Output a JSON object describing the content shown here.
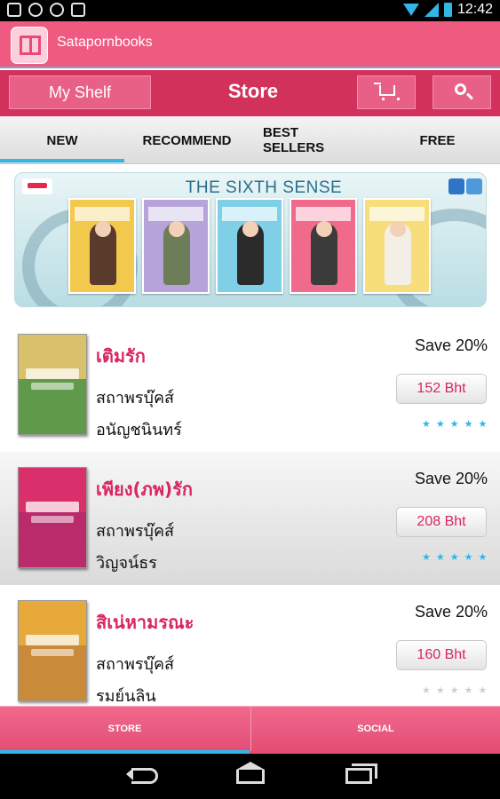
{
  "status_bar": {
    "time": "12:42",
    "icons": [
      "image-icon",
      "cloud-upload-icon",
      "clock-icon",
      "bag-icon"
    ],
    "right_icons": [
      "wifi-icon",
      "signal-icon",
      "battery-icon"
    ]
  },
  "app_bar": {
    "title": "Satapornbooks"
  },
  "header": {
    "my_shelf_label": "My Shelf",
    "store_title": "Store"
  },
  "tabs": [
    {
      "label": "NEW",
      "selected": true
    },
    {
      "label": "RECOMMEND",
      "selected": false
    },
    {
      "label": "BEST\nSELLERS",
      "selected": false
    },
    {
      "label": "FREE",
      "selected": false
    }
  ],
  "banner": {
    "title": "THE SIXTH SENSE"
  },
  "books": [
    {
      "title": "เติมรัก",
      "publisher": "สถาพรบุ๊คส์",
      "author": "อนัญชนินทร์",
      "save": "Save 20%",
      "price": "152 Bht",
      "rating_active": true
    },
    {
      "title": "เพียง(ภพ)รัก",
      "publisher": "สถาพรบุ๊คส์",
      "author": "วิญจน์ธร",
      "save": "Save 20%",
      "price": "208 Bht",
      "rating_active": true
    },
    {
      "title": "สิเน่หามรณะ",
      "publisher": "สถาพรบุ๊คส์",
      "author": "รมย์นลิน",
      "save": "Save 20%",
      "price": "160 Bht",
      "rating_active": false
    }
  ],
  "stars": "★★★★★",
  "bottom_tabs": [
    {
      "label": "STORE",
      "selected": true
    },
    {
      "label": "SOCIAL",
      "selected": false
    }
  ],
  "colors": {
    "accent_pink": "#ef5a80",
    "header_pink": "#d2315c",
    "title_pink": "#d72660",
    "holo_blue": "#33b5e5"
  }
}
